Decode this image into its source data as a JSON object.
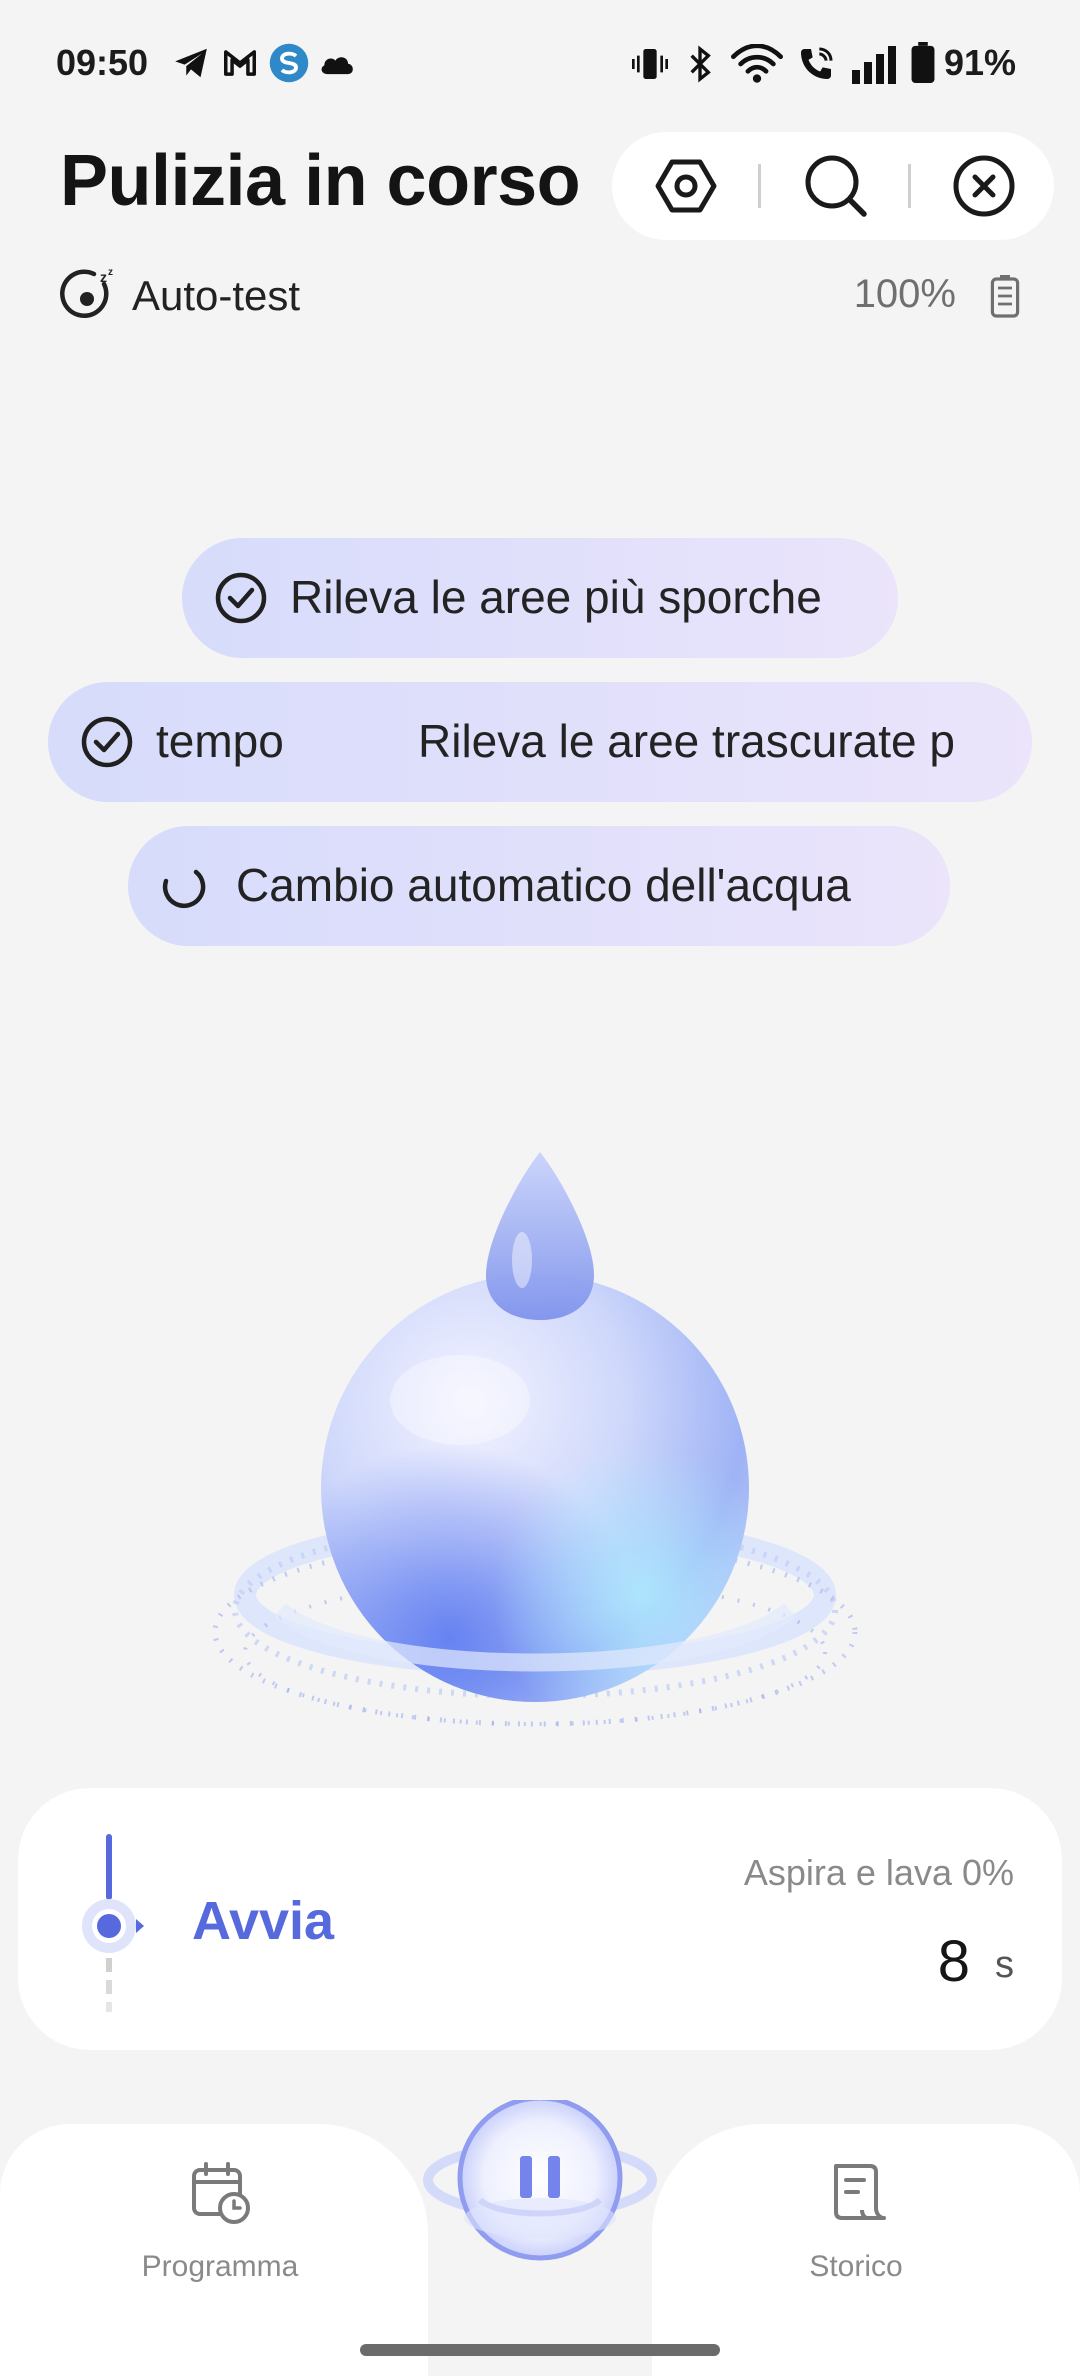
{
  "status_bar": {
    "time": "09:50",
    "battery_percent": "91%",
    "left_icons": [
      "telegram-icon",
      "gmail-icon",
      "app-s-icon",
      "cloud-icon"
    ],
    "right_icons": [
      "vibrate-icon",
      "bluetooth-icon",
      "wifi-icon",
      "wifi-call-icon",
      "signal-icon",
      "battery-icon"
    ]
  },
  "header": {
    "title": "Pulizia in corso",
    "actions": [
      "settings-icon",
      "search-icon",
      "close-icon"
    ]
  },
  "subheader": {
    "mode": "Auto-test",
    "device_battery": "100%"
  },
  "tasks": [
    {
      "label": "Rileva le aree più sporche",
      "state": "done"
    },
    {
      "label": "tempo",
      "label_2": "Rileva le aree trascurate p",
      "state": "done"
    },
    {
      "label": "Cambio automatico dell'acqua",
      "state": "in-progress"
    }
  ],
  "progress": {
    "phase": "Avvia",
    "description": "Aspira e lava 0%",
    "timer_value": "8",
    "timer_unit": "s"
  },
  "bottom_nav": {
    "schedule_label": "Programma",
    "history_label": "Storico",
    "center_action": "pause-icon"
  },
  "colors": {
    "accent": "#5669dd",
    "chip_start": "#d7dcfb",
    "chip_end": "#ebe4fb",
    "background": "#f4f4f4"
  }
}
